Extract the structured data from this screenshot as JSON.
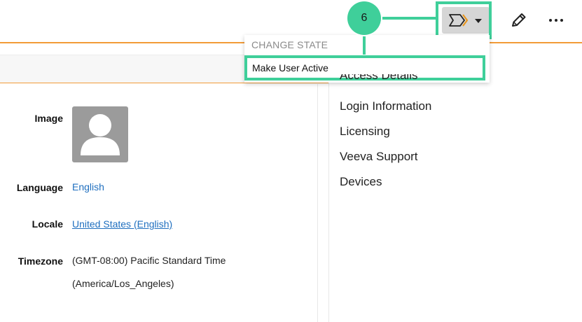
{
  "annotation": {
    "step_number": "6",
    "highlight_color": "#3fcf9a"
  },
  "toolbar": {
    "state_button_icon": "workflow-chevron-icon",
    "edit_icon": "pencil-icon",
    "more_icon": "ellipsis-icon"
  },
  "dropdown": {
    "header": "CHANGE STATE",
    "items": [
      {
        "label": "Make User Active"
      }
    ]
  },
  "details": {
    "image_label": "Image",
    "language_label": "Language",
    "language_value": "English",
    "locale_label": "Locale",
    "locale_value": "United States (English)",
    "timezone_label": "Timezone",
    "timezone_value_line1": "(GMT-08:00) Pacific Standard Time",
    "timezone_value_line2": "(America/Los_Angeles)"
  },
  "sidenav": {
    "items": [
      {
        "label": "Access Details"
      },
      {
        "label": "Login Information"
      },
      {
        "label": "Licensing"
      },
      {
        "label": "Veeva Support"
      },
      {
        "label": "Devices"
      }
    ]
  },
  "colors": {
    "accent_orange": "#f29b38",
    "link_blue": "#1f6fbf",
    "button_gray": "#d6d6d6"
  }
}
